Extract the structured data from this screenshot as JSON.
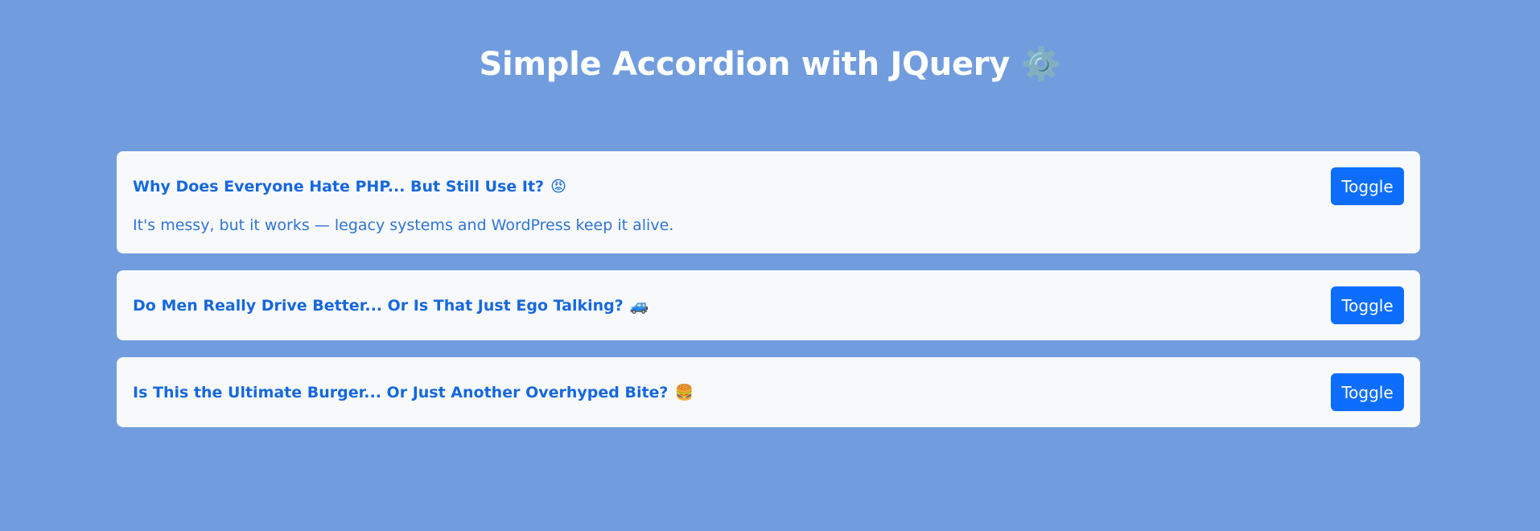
{
  "header": {
    "title": "Simple Accordion with JQuery",
    "title_icon": "⚙️"
  },
  "accordion": {
    "items": [
      {
        "question": "Why Does Everyone Hate PHP... But Still Use It?",
        "emoji": "😡",
        "answer": "It's messy, but it works — legacy systems and WordPress keep it alive.",
        "toggle_label": "Toggle",
        "expanded": true
      },
      {
        "question": "Do Men Really Drive Better... Or Is That Just Ego Talking?",
        "emoji": "🚙",
        "answer": "",
        "toggle_label": "Toggle",
        "expanded": false
      },
      {
        "question": "Is This the Ultimate Burger... Or Just Another Overhyped Bite?",
        "emoji": "🍔",
        "answer": "",
        "toggle_label": "Toggle",
        "expanded": false
      }
    ]
  },
  "colors": {
    "background": "#719ddf",
    "card": "#f8f9fb",
    "question_text": "#1668dd",
    "answer_text": "#2f74d6",
    "button": "#0d6efd",
    "title_text": "#ffffff"
  }
}
